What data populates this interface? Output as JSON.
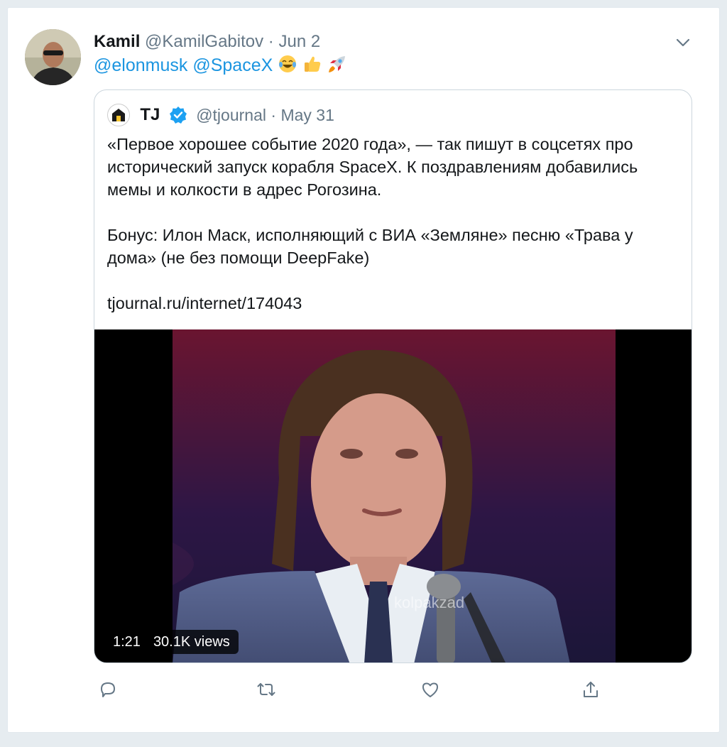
{
  "tweet": {
    "author_name": "Kamil",
    "author_handle": "@KamilGabitov",
    "separator": "·",
    "date": "Jun 2",
    "mentions": [
      "@elonmusk",
      "@SpaceX"
    ],
    "emojis": [
      "face-with-tears-of-joy-icon",
      "thumbs-up-icon",
      "rocket-icon"
    ]
  },
  "quote": {
    "author_name": "TJ",
    "author_handle": "@tjournal",
    "separator": "·",
    "date": "May 31",
    "paragraph1": "«Первое хорошее событие 2020 года», — так пишут в соцсетях про исторический запуск корабля SpaceX. К поздравлениям добавились мемы и колкости в адрес Рогозина.",
    "paragraph2": "Бонус: Илон Маск, исполняющий с ВИА «Земляне» песню «Трава у дома» (не без помощи DeepFake)",
    "link": "tjournal.ru/internet/174043",
    "video": {
      "duration": "1:21",
      "views": "30.1K views",
      "watermark": "kolpakzad"
    }
  },
  "actions": [
    "reply-icon",
    "retweet-icon",
    "like-icon",
    "share-icon"
  ],
  "colors": {
    "link": "#1b95e0",
    "muted": "#657786",
    "border": "#ccd6dd",
    "verified": "#1da1f2"
  }
}
